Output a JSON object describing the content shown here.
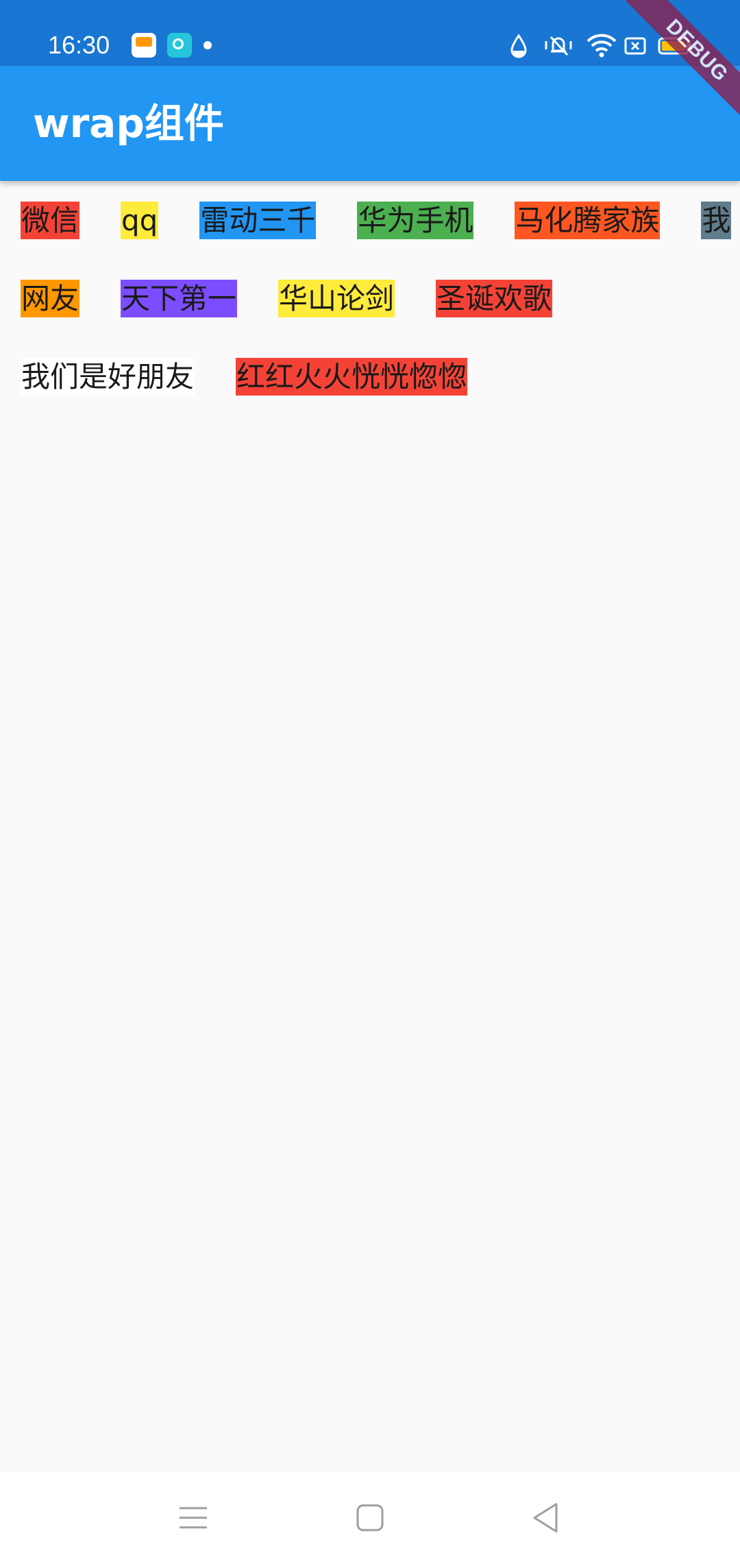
{
  "status_bar": {
    "time": "16:30",
    "background": "#1976d2",
    "left_icons": [
      "app-store-icon",
      "game-center-icon",
      "notification-dot-icon"
    ],
    "right_icons": [
      "water-drop-icon",
      "vibrate-mute-icon",
      "wifi-icon",
      "nfc-icon",
      "battery-icon"
    ],
    "battery_color": "#ffc107"
  },
  "debug_banner": {
    "label": "DEBUG",
    "color": "#8b2252"
  },
  "app_bar": {
    "title": "wrap组件",
    "background": "#2196f3"
  },
  "wrap": {
    "chips": [
      {
        "label": "微信",
        "color": "#f44336"
      },
      {
        "label": "qq",
        "color": "#ffeb3b"
      },
      {
        "label": "雷动三千",
        "color": "#2196f3"
      },
      {
        "label": "华为手机",
        "color": "#4caf50"
      },
      {
        "label": "马化腾家族",
        "color": "#ff5722"
      },
      {
        "label": "我",
        "color": "#607d8b"
      },
      {
        "label": "网友",
        "color": "#ff9800"
      },
      {
        "label": "天下第一",
        "color": "#7c4dff"
      },
      {
        "label": "华山论剑",
        "color": "#ffeb3b"
      },
      {
        "label": "圣诞欢歌",
        "color": "#f44336"
      },
      {
        "label": "我们是好朋友",
        "color": "#ffffff"
      },
      {
        "label": "红红火火恍恍惚惚",
        "color": "#f44336"
      }
    ]
  },
  "nav_bar": {
    "buttons": [
      "menu-icon",
      "home-square-icon",
      "back-triangle-icon"
    ]
  }
}
